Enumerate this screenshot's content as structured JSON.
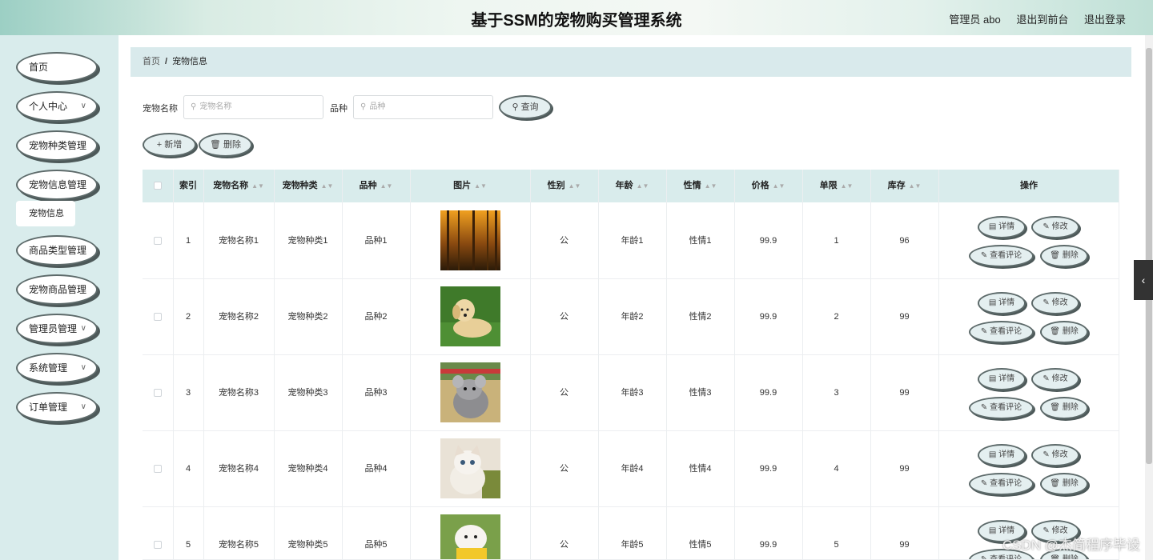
{
  "header": {
    "title": "基于SSM的宠物购买管理系统",
    "user": "管理员 abo",
    "to_front": "退出到前台",
    "logout": "退出登录"
  },
  "sidebar": {
    "items": [
      {
        "label": "首页",
        "has_chevron": false
      },
      {
        "label": "个人中心",
        "has_chevron": true
      },
      {
        "label": "宠物种类管理",
        "has_chevron": false
      },
      {
        "label": "宠物信息管理",
        "has_chevron": false
      },
      {
        "label": "商品类型管理",
        "has_chevron": false
      },
      {
        "label": "宠物商品管理",
        "has_chevron": false
      },
      {
        "label": "管理员管理",
        "has_chevron": true
      },
      {
        "label": "系统管理",
        "has_chevron": true
      },
      {
        "label": "订单管理",
        "has_chevron": true
      }
    ],
    "active_sub": "宠物信息"
  },
  "breadcrumb": {
    "home": "首页",
    "sep": "/",
    "current": "宠物信息"
  },
  "search": {
    "name_label": "宠物名称",
    "name_placeholder": "宠物名称",
    "breed_label": "品种",
    "breed_placeholder": "品种",
    "query_button": "查询"
  },
  "toolbar": {
    "add": "新增",
    "delete": "删除"
  },
  "table": {
    "headers": {
      "index": "索引",
      "name": "宠物名称",
      "type": "宠物种类",
      "breed": "品种",
      "image": "图片",
      "gender": "性别",
      "age": "年龄",
      "temper": "性情",
      "price": "价格",
      "limit": "单限",
      "stock": "库存",
      "ops": "操作"
    },
    "ops": {
      "detail": "详情",
      "edit": "修改",
      "comments": "查看评论",
      "delete": "删除"
    },
    "rows": [
      {
        "index": "1",
        "name": "宠物名称1",
        "type": "宠物种类1",
        "breed": "品种1",
        "gender": "公",
        "age": "年龄1",
        "temper": "性情1",
        "price": "99.9",
        "limit": "1",
        "stock": "96"
      },
      {
        "index": "2",
        "name": "宠物名称2",
        "type": "宠物种类2",
        "breed": "品种2",
        "gender": "公",
        "age": "年龄2",
        "temper": "性情2",
        "price": "99.9",
        "limit": "2",
        "stock": "99"
      },
      {
        "index": "3",
        "name": "宠物名称3",
        "type": "宠物种类3",
        "breed": "品种3",
        "gender": "公",
        "age": "年龄3",
        "temper": "性情3",
        "price": "99.9",
        "limit": "3",
        "stock": "99"
      },
      {
        "index": "4",
        "name": "宠物名称4",
        "type": "宠物种类4",
        "breed": "品种4",
        "gender": "公",
        "age": "年龄4",
        "temper": "性情4",
        "price": "99.9",
        "limit": "4",
        "stock": "99"
      },
      {
        "index": "5",
        "name": "宠物名称5",
        "type": "宠物种类5",
        "breed": "品种5",
        "gender": "公",
        "age": "年龄5",
        "temper": "性情5",
        "price": "99.9",
        "limit": "5",
        "stock": "99"
      }
    ]
  },
  "watermark": "CSDN @杰简程序毕设"
}
